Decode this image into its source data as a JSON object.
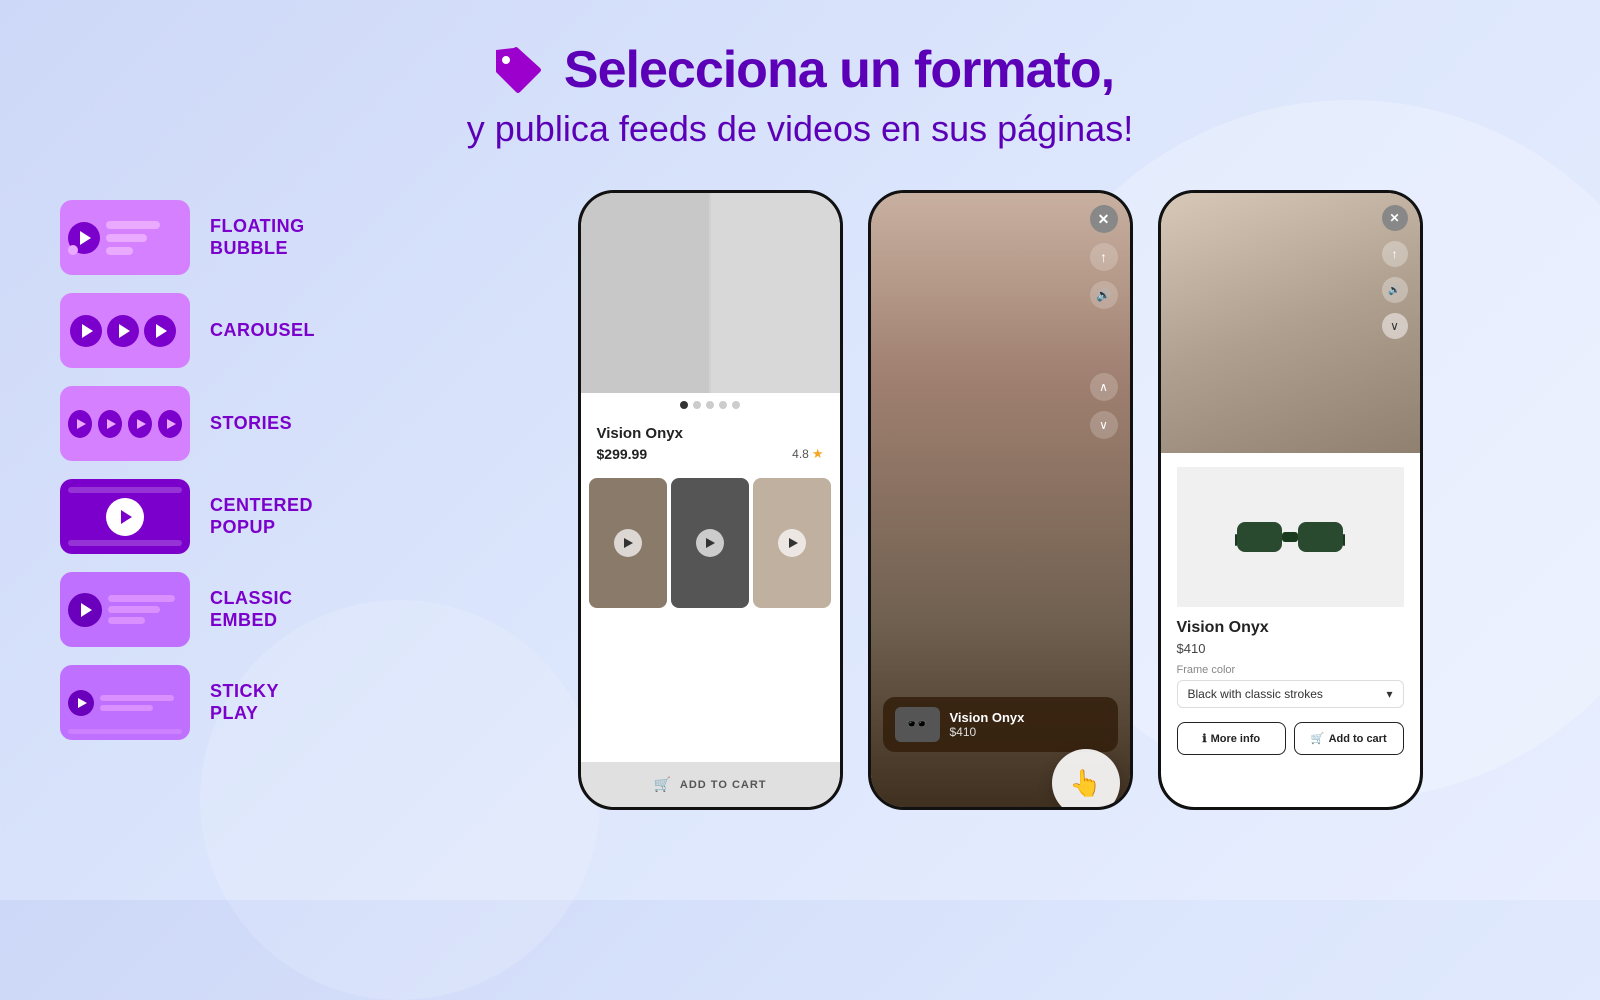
{
  "header": {
    "title": "Selecciona un formato,",
    "subtitle": "y publica feeds de videos en sus páginas!"
  },
  "sidebar": {
    "items": [
      {
        "id": "floating-bubble",
        "label": "FLOATING\nBUBBLE"
      },
      {
        "id": "carousel",
        "label": "CAROUSEL"
      },
      {
        "id": "stories",
        "label": "STORIES"
      },
      {
        "id": "centered-popup",
        "label": "CENTERED\nPOPUP"
      },
      {
        "id": "classic-embed",
        "label": "CLASSIC\nEMBED"
      },
      {
        "id": "sticky-play",
        "label": "STICKY\nPLAY"
      }
    ]
  },
  "phone1": {
    "product_name": "Vision Onyx",
    "price": "$299.99",
    "rating": "4.8",
    "add_to_cart": "ADD TO CART"
  },
  "phone2": {
    "product_name": "Vision Onyx",
    "product_price": "$410"
  },
  "phone3": {
    "product_name": "Vision Onyx",
    "price": "$410",
    "frame_color_label": "Frame color",
    "frame_color_value": "Black with classic strokes",
    "btn_more_info": "More info",
    "btn_add_to_cart": "Add to cart"
  }
}
